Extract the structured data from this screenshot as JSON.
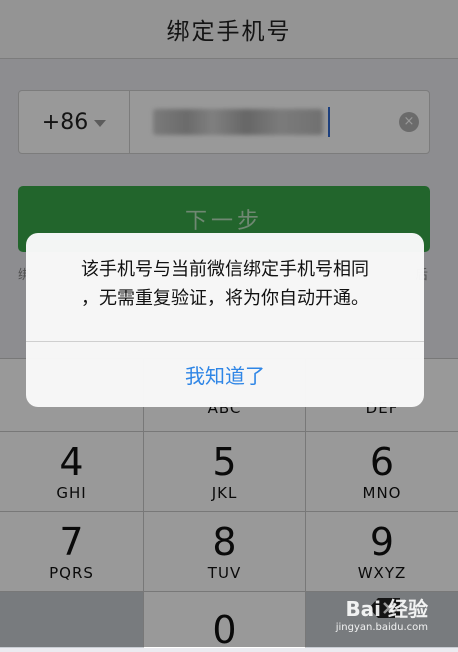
{
  "navbar": {
    "title": "绑定手机号"
  },
  "phone": {
    "country_code": "+86",
    "clear_icon": "×"
  },
  "next_button": {
    "label": "下一步"
  },
  "hint": {
    "left": "绑",
    "right": "后"
  },
  "keyboard": {
    "keys": [
      {
        "number": "",
        "letters": ""
      },
      {
        "number": "",
        "letters": "ABC"
      },
      {
        "number": "",
        "letters": "DEF"
      },
      {
        "number": "4",
        "letters": "GHI"
      },
      {
        "number": "5",
        "letters": "JKL"
      },
      {
        "number": "6",
        "letters": "MNO"
      },
      {
        "number": "7",
        "letters": "PQRS"
      },
      {
        "number": "8",
        "letters": "TUV"
      },
      {
        "number": "9",
        "letters": "WXYZ"
      },
      {
        "number": "",
        "letters": ""
      },
      {
        "number": "0",
        "letters": ""
      },
      {
        "number": "",
        "letters": ""
      }
    ]
  },
  "alert": {
    "message_line1": "该手机号与当前微信绑定手机号相同",
    "message_line2": "，无需重复验证，将为你自动开通。",
    "ok_label": "我知道了"
  },
  "watermark": {
    "brand": "Bai 经验",
    "sub": "jingyan.baidu.com"
  },
  "colors": {
    "accent_green": "#3aa84a",
    "link_blue": "#2f86e6"
  }
}
